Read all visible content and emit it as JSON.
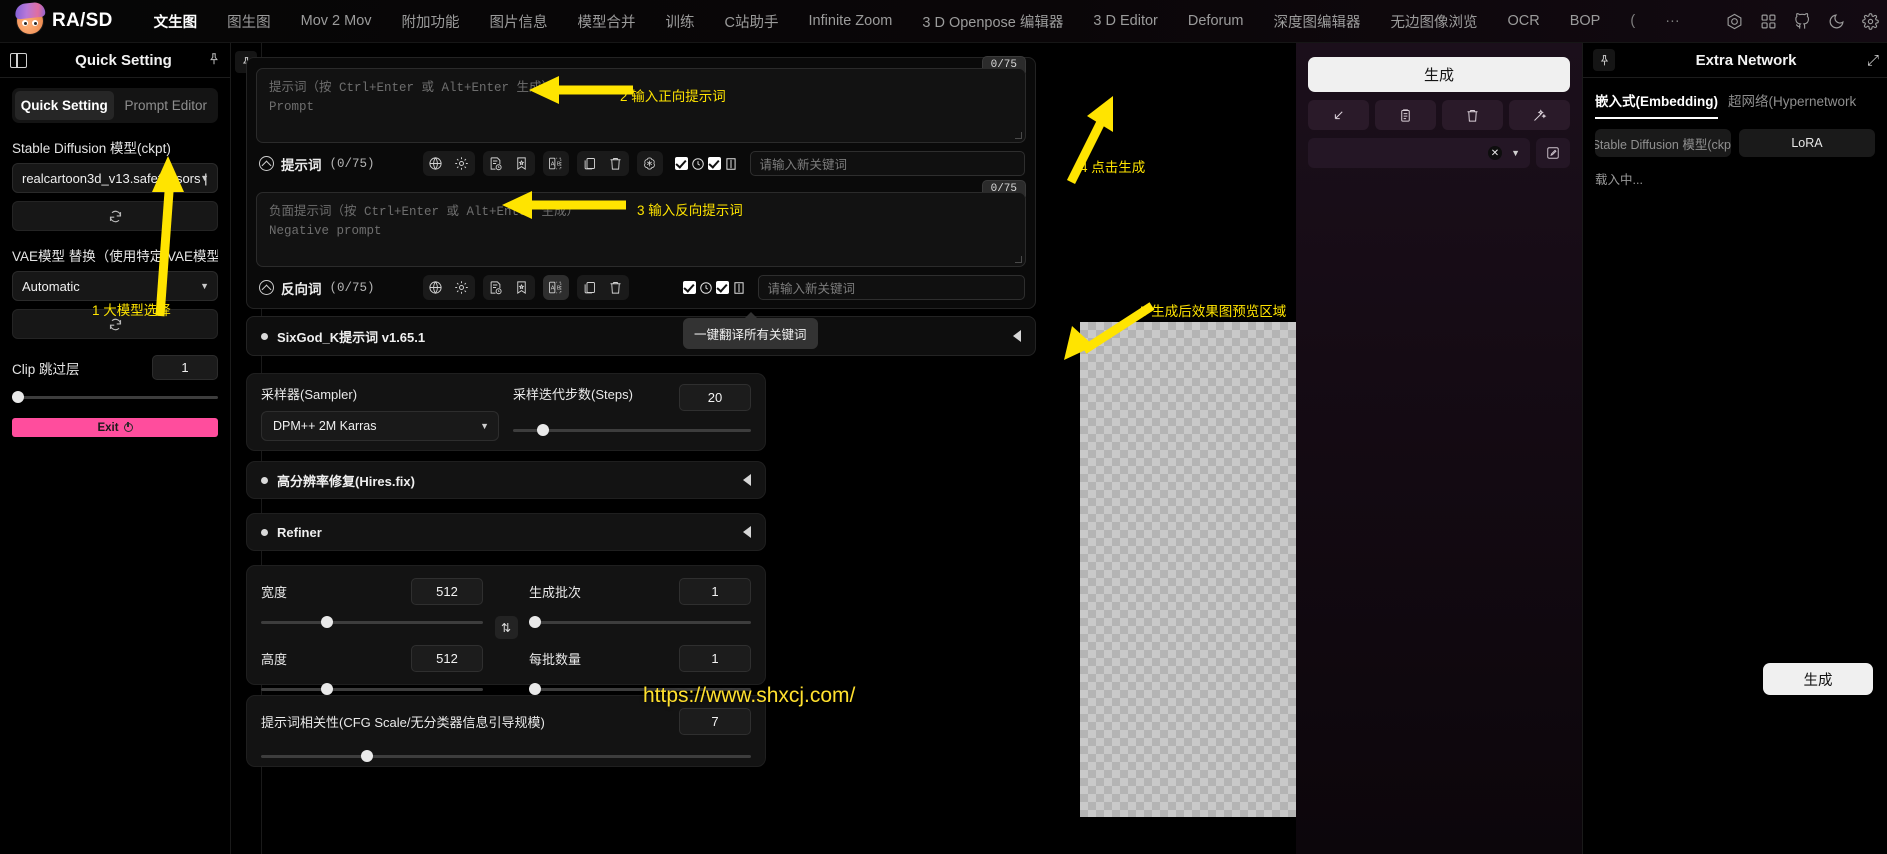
{
  "app": {
    "brand": "RA/SD",
    "watermark": "https://www.shxcj.com/"
  },
  "topnav": {
    "tabs": [
      {
        "label": "文生图",
        "active": true
      },
      {
        "label": "图生图",
        "active": false
      },
      {
        "label": "Mov 2 Mov",
        "active": false
      },
      {
        "label": "附加功能",
        "active": false
      },
      {
        "label": "图片信息",
        "active": false
      },
      {
        "label": "模型合并",
        "active": false
      },
      {
        "label": "训练",
        "active": false
      },
      {
        "label": "C站助手",
        "active": false
      },
      {
        "label": "Infinite Zoom",
        "active": false
      },
      {
        "label": "3 D Openpose 编辑器",
        "active": false
      },
      {
        "label": "3 D Editor",
        "active": false
      },
      {
        "label": "Deforum",
        "active": false
      },
      {
        "label": "深度图编辑器",
        "active": false
      },
      {
        "label": "无边图像浏览",
        "active": false
      },
      {
        "label": "OCR",
        "active": false
      },
      {
        "label": "BOP",
        "active": false
      },
      {
        "label": "(",
        "active": false
      },
      {
        "label": "···",
        "active": false
      }
    ],
    "icons": [
      "civitai-icon",
      "grid-icon",
      "github-icon",
      "moon-icon",
      "gear-icon"
    ]
  },
  "sidebar": {
    "title": "Quick Setting",
    "tabs": [
      {
        "label": "Quick Setting",
        "active": true
      },
      {
        "label": "Prompt Editor",
        "active": false
      }
    ],
    "model_label": "Stable Diffusion 模型(ckpt)",
    "model_value": "realcartoon3d_v13.safetensors |",
    "vae_label": "VAE模型 替换（使用特定 VAE模型 替...",
    "vae_value": "Automatic",
    "clip_label": "Clip 跳过层",
    "clip_value": "1",
    "exit_label": "Exit"
  },
  "prompt": {
    "positive": {
      "placeholder_line1": "提示词（按 Ctrl+Enter 或 Alt+Enter 生成）",
      "placeholder_line2": "Prompt",
      "counter": "0/75",
      "title": "提示词",
      "count": "(0/75)",
      "keyword_placeholder": "请输入新关键词"
    },
    "negative": {
      "placeholder_line1": "负面提示词（按 Ctrl+Enter 或 Alt+Enter 生成）",
      "placeholder_line2": "Negative prompt",
      "counter": "0/75",
      "title": "反向词",
      "count": "(0/75)",
      "keyword_placeholder": "请输入新关键词"
    },
    "tooltip": "一键翻译所有关键词"
  },
  "sixgod": {
    "label": "SixGod_K提示词 v1.65.1"
  },
  "settings": {
    "sampler_label": "采样器(Sampler)",
    "sampler_value": "DPM++ 2M Karras",
    "steps_label": "采样迭代步数(Steps)",
    "steps_value": "20",
    "hires_label": "高分辨率修复(Hires.fix)",
    "refiner_label": "Refiner",
    "width_label": "宽度",
    "width_value": "512",
    "height_label": "高度",
    "height_value": "512",
    "batch_count_label": "生成批次",
    "batch_count_value": "1",
    "batch_size_label": "每批数量",
    "batch_size_value": "1",
    "cfg_label": "提示词相关性(CFG Scale/无分类器信息引导规模)",
    "cfg_value": "7"
  },
  "generate": {
    "main_label": "生成",
    "icons": [
      "arrow-down-left-icon",
      "clipboard-icon",
      "trash-icon",
      "magic-wand-icon"
    ],
    "edit_icon": "edit-icon"
  },
  "extra": {
    "title": "Extra Network",
    "tabs": [
      {
        "label": "嵌入式(Embedding)",
        "active": true
      },
      {
        "label": "超网络(Hypernetwork",
        "active": false
      }
    ],
    "chips": [
      {
        "label": "Stable Diffusion 模型(ckpt",
        "active": false
      },
      {
        "label": "LoRA",
        "active": true
      }
    ],
    "loading": "载入中...",
    "generate_label": "生成"
  },
  "annotations": [
    {
      "id": "a1",
      "text": "1 大模型选择"
    },
    {
      "id": "a2",
      "text": "2 输入正向提示词"
    },
    {
      "id": "a3",
      "text": "3 输入反向提示词"
    },
    {
      "id": "a4",
      "text": "4 点击生成"
    },
    {
      "id": "a5",
      "text": "5 生成后效果图预览区域"
    }
  ],
  "colors": {
    "accent_yellow": "#ffe400",
    "exit_pink": "#ff4d9d",
    "generate_bg": "#f0f0f0"
  }
}
